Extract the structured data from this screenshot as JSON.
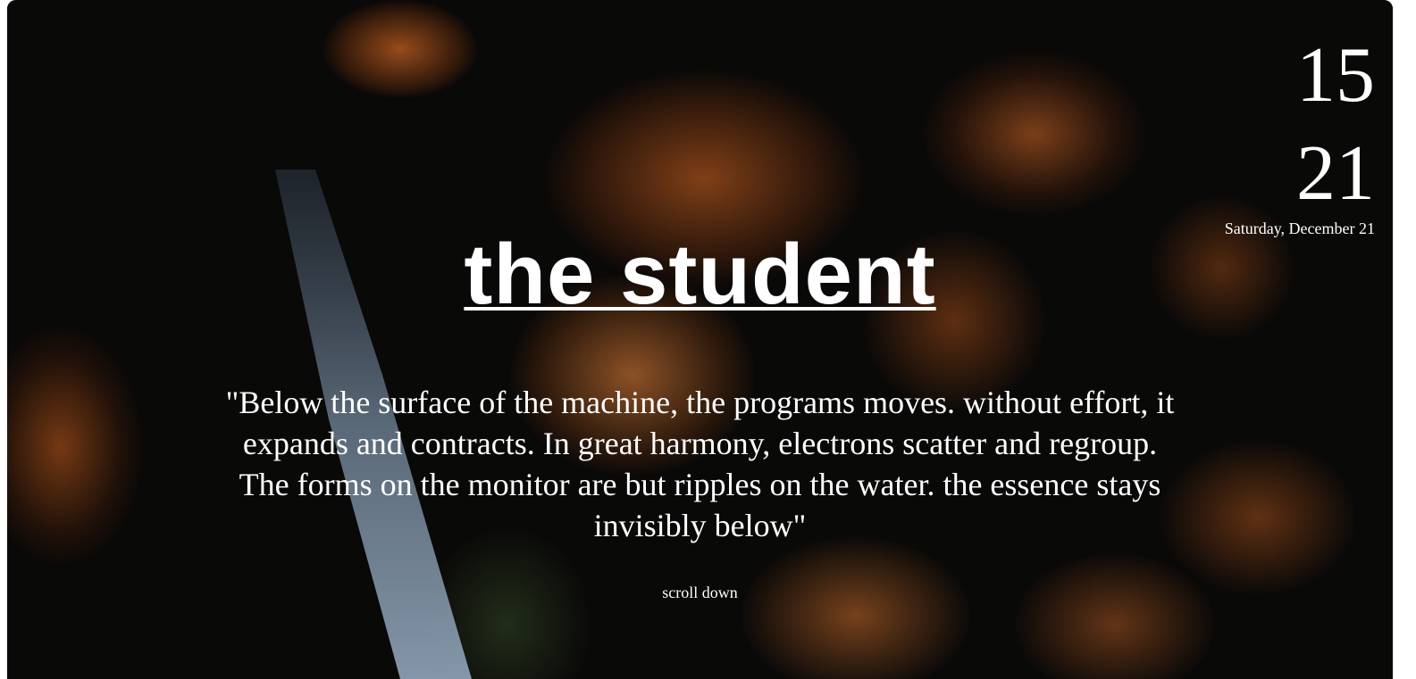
{
  "clock": {
    "hours": "15",
    "minutes": "21",
    "date": "Saturday, December 21"
  },
  "hero": {
    "title": "the student",
    "quote": "\"Below the surface of the machine, the programs moves. without effort, it expands and contracts. In great harmony, electrons scatter and regroup. The forms on the monitor are but ripples on the water. the essence stays invisibly below\"",
    "scroll_label": "scroll down"
  },
  "colors": {
    "text": "#ffffff",
    "foliage": "#d06a26",
    "background": "#0c0b0a"
  }
}
